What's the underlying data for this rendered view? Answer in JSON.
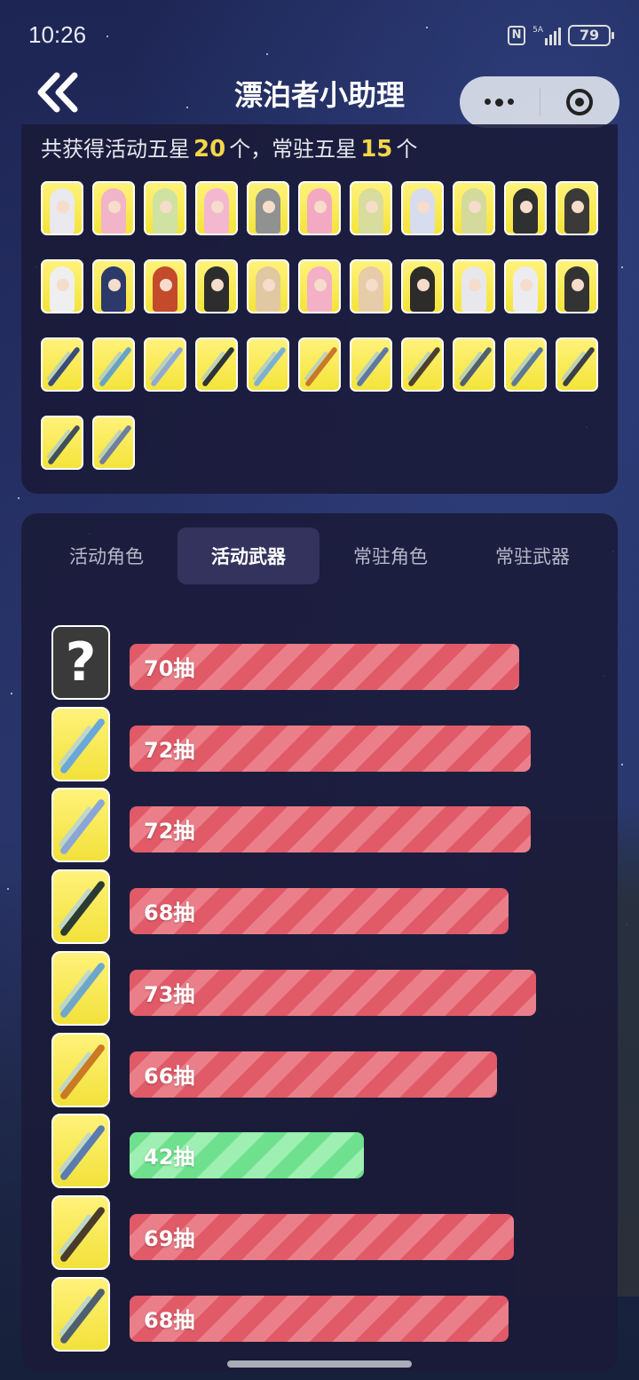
{
  "status_bar": {
    "time": "10:26",
    "network": "5A",
    "battery": "79"
  },
  "header": {
    "title": "漂泊者小助理"
  },
  "summary": {
    "prefix": "共获得活动五星",
    "event_count": "20",
    "mid": "个，常驻五星",
    "standard_count": "15",
    "suffix": "个"
  },
  "tabs": [
    {
      "label": "活动角色",
      "active": false
    },
    {
      "label": "活动武器",
      "active": true
    },
    {
      "label": "常驻角色",
      "active": false
    },
    {
      "label": "常驻武器",
      "active": false
    }
  ],
  "pulls": [
    {
      "label": "70抽",
      "value": 70,
      "item": "unknown",
      "good": false
    },
    {
      "label": "72抽",
      "value": 72,
      "item": "weapon",
      "good": false
    },
    {
      "label": "72抽",
      "value": 72,
      "item": "weapon",
      "good": false
    },
    {
      "label": "68抽",
      "value": 68,
      "item": "weapon",
      "good": false
    },
    {
      "label": "73抽",
      "value": 73,
      "item": "weapon",
      "good": false
    },
    {
      "label": "66抽",
      "value": 66,
      "item": "weapon",
      "good": false
    },
    {
      "label": "42抽",
      "value": 42,
      "item": "weapon",
      "good": true
    },
    {
      "label": "69抽",
      "value": 69,
      "item": "weapon",
      "good": false
    },
    {
      "label": "68抽",
      "value": 68,
      "item": "weapon",
      "good": false
    }
  ],
  "unknown_glyph": "?",
  "collection": {
    "characters": 22,
    "weapons": 13
  },
  "colors": {
    "accent_gold": "#f5d64a",
    "bar_red": "#e05a68",
    "bar_green": "#6fe08e",
    "icon_bg": "#f4e43a"
  }
}
